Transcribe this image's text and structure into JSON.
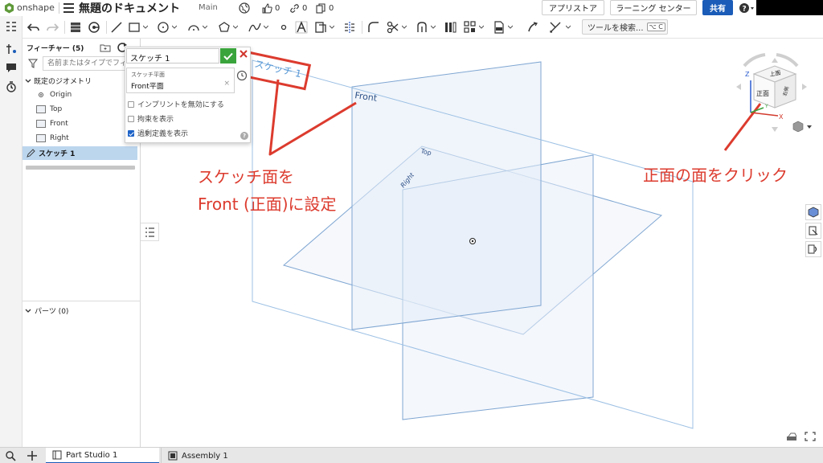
{
  "header": {
    "brand": "onshape",
    "document_title": "無題のドキュメント",
    "branch": "Main",
    "likes": "0",
    "links": "0",
    "copies": "0",
    "app_store": "アプリストア",
    "learning_center": "ラーニング センター",
    "share": "共有"
  },
  "toolbar": {
    "search_label": "ツールを検索...",
    "search_shortcut": "⌥ C"
  },
  "feature_panel": {
    "title": "フィーチャー (5)",
    "search_placeholder": "名前またはタイプでフィルター",
    "default_geometry": "既定のジオメトリ",
    "items": [
      "Origin",
      "Top",
      "Front",
      "Right"
    ],
    "sketch_item": "スケッチ 1",
    "parts": "パーツ (0)"
  },
  "sketch_dialog": {
    "name": "スケッチ 1",
    "plane_label": "スケッチ平面",
    "plane_value": "Front平面",
    "options": [
      {
        "label": "インプリントを無効にする",
        "checked": false
      },
      {
        "label": "拘束を表示",
        "checked": false
      },
      {
        "label": "過剰定義を表示",
        "checked": true
      }
    ]
  },
  "viewport": {
    "sketch_label": "スケッチ 1",
    "plane_front": "Front",
    "plane_top": "Top",
    "plane_right": "Right"
  },
  "view_cube": {
    "top": "上面",
    "front": "正面",
    "right": "右側",
    "axis_x": "X",
    "axis_y": "Y",
    "axis_z": "Z"
  },
  "annotations": {
    "left_line1": "スケッチ面を",
    "left_line2": "Front (正面)に設定",
    "right": "正面の面をクリック"
  },
  "tabs": [
    {
      "label": "Part Studio 1",
      "active": true
    },
    {
      "label": "Assembly 1",
      "active": false
    }
  ],
  "colors": {
    "accent": "#1a5cb8",
    "annotation": "#dc3b2e",
    "ok": "#3aa43c",
    "selection": "#bcd6ee",
    "plane_edge": "#7fa6d2"
  }
}
